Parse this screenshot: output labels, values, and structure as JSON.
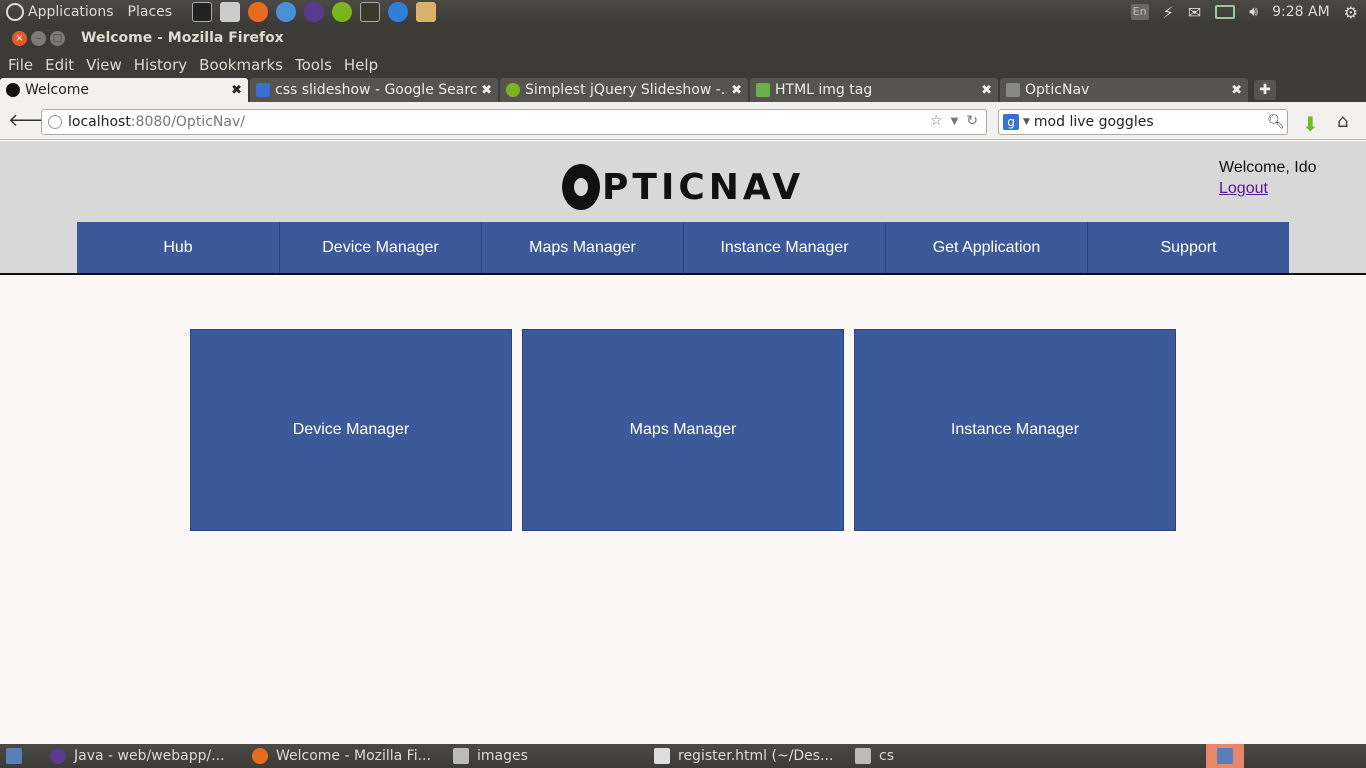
{
  "system": {
    "menus": [
      "Applications",
      "Places"
    ],
    "clock": "9:28 AM",
    "keyboard_layout": "En"
  },
  "window": {
    "title": "Welcome - Mozilla Firefox"
  },
  "menubar": [
    "File",
    "Edit",
    "View",
    "History",
    "Bookmarks",
    "Tools",
    "Help"
  ],
  "tabs": [
    {
      "label": "Welcome",
      "active": true,
      "icon": "opticnav-icon"
    },
    {
      "label": "css slideshow - Google Search",
      "icon": "google-icon"
    },
    {
      "label": "Simplest jQuery Slideshow -...",
      "icon": "jquery-icon"
    },
    {
      "label": "HTML img tag",
      "icon": "w3-icon"
    },
    {
      "label": "OpticNav",
      "icon": "blank-page-icon"
    }
  ],
  "toolbar": {
    "url_host": "localhost",
    "url_path": ":8080/OpticNav/",
    "search_query": "mod live goggles"
  },
  "page": {
    "logo_text": "PTICNAV",
    "welcome": "Welcome, Ido",
    "logout": "Logout",
    "nav": [
      "Hub",
      "Device Manager",
      "Maps Manager",
      "Instance Manager",
      "Get Application",
      "Support"
    ],
    "tiles": [
      "Device Manager",
      "Maps Manager",
      "Instance Manager"
    ]
  },
  "taskbar": [
    {
      "label": "Java - web/webapp/..."
    },
    {
      "label": "Welcome - Mozilla Fi..."
    },
    {
      "label": "images"
    },
    {
      "label": "register.html (~/Des..."
    },
    {
      "label": "cs"
    }
  ],
  "colors": {
    "nav_blue": "#3c5a9a",
    "header_gray": "#d8d8d8",
    "page_bg": "#fcf8f7"
  }
}
